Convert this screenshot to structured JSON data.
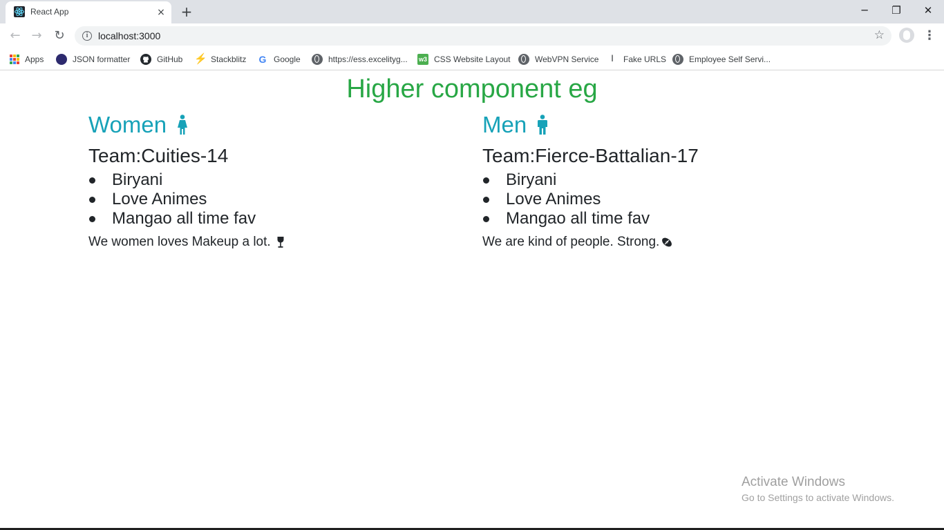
{
  "browser": {
    "tab_title": "React App",
    "tab_close": "×",
    "new_tab": "+",
    "url": "localhost:3000",
    "window_controls": {
      "minimize": "─",
      "restore": "❐",
      "close": "✕"
    }
  },
  "bookmarks": [
    {
      "label": "Apps",
      "icon": "apps-grid-icon"
    },
    {
      "label": "JSON formatter",
      "icon": "json-formatter-icon"
    },
    {
      "label": "GitHub",
      "icon": "github-icon"
    },
    {
      "label": "Stackblitz",
      "icon": "stackblitz-icon"
    },
    {
      "label": "Google",
      "icon": "google-icon"
    },
    {
      "label": "https://ess.excelityg...",
      "icon": "globe-icon"
    },
    {
      "label": "CSS Website Layout",
      "icon": "w3schools-icon"
    },
    {
      "label": "WebVPN Service",
      "icon": "globe-icon"
    },
    {
      "label": "Fake URLS",
      "icon": "fake-urls-icon"
    },
    {
      "label": "Employee Self Servi...",
      "icon": "globe-icon"
    }
  ],
  "page": {
    "heading": "Higher component eg",
    "women": {
      "title": "Women",
      "team": "Team:Cuities-14",
      "favourites": [
        "Biryani",
        "Love Animes",
        "Mangao all time fav"
      ],
      "note": "We women loves Makeup a lot."
    },
    "men": {
      "title": "Men",
      "team": "Team:Fierce-Battalian-17",
      "favourites": [
        "Biryani",
        "Love Animes",
        "Mangao all time fav"
      ],
      "note": "We are kind of people. Strong."
    }
  },
  "watermark": {
    "line1": "Activate Windows",
    "line2": "Go to Settings to activate Windows."
  },
  "colors": {
    "heading": "#28a745",
    "section_title": "#17a2b8",
    "text": "#212529"
  }
}
